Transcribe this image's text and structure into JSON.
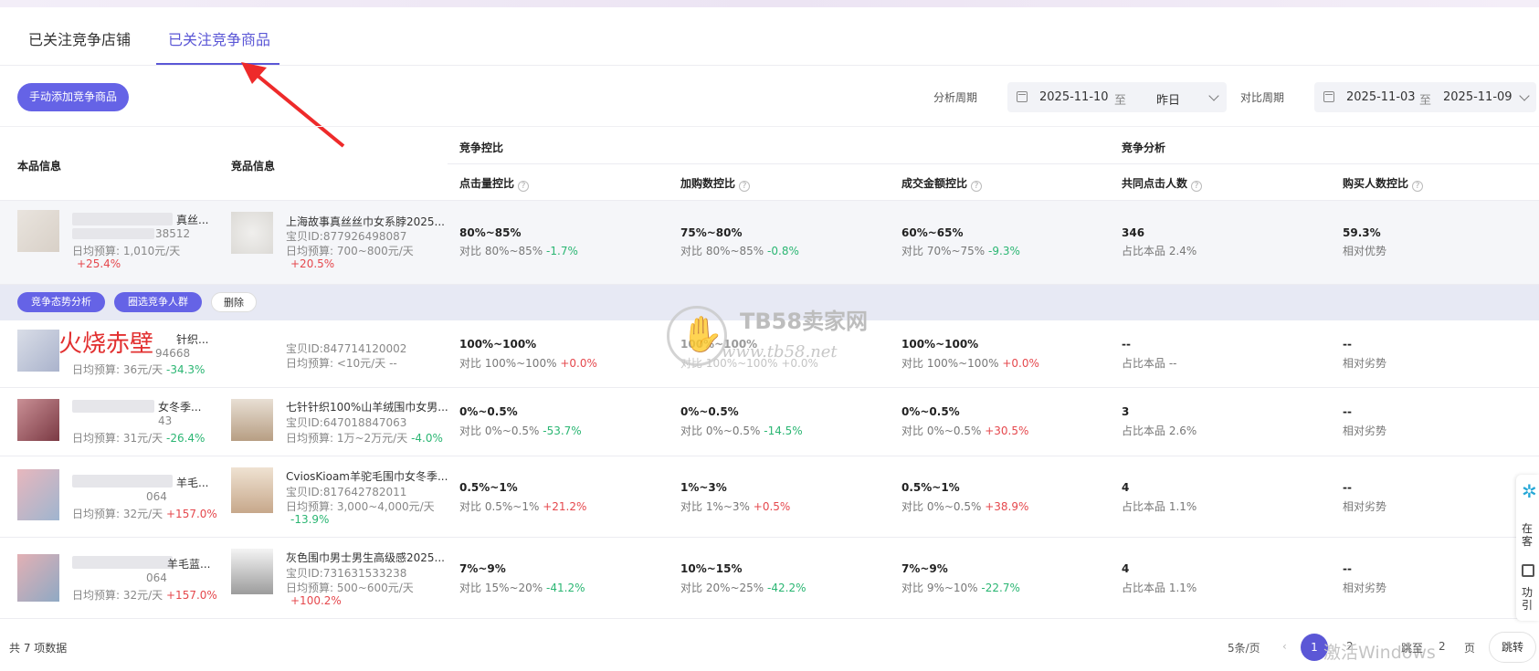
{
  "tabs": [
    "已关注竞争店铺",
    "已关注竞争商品"
  ],
  "toolbar": {
    "add_button": "手动添加竞争商品",
    "analysis_label": "分析周期",
    "analysis_start": "2025-11-10",
    "analysis_sep": "至",
    "analysis_end": "昨日",
    "compare_label": "对比周期",
    "compare_start": "2025-11-03",
    "compare_sep": "至",
    "compare_end": "2025-11-09"
  },
  "header": {
    "own": "本品信息",
    "competitor": "竞品信息",
    "group1": "竞争控比",
    "group2": "竞争分析",
    "cols": [
      "点击量控比",
      "加购数控比",
      "成交金额控比",
      "共同点击人数",
      "购买人数控比"
    ]
  },
  "rows": [
    {
      "own_title": "真丝...",
      "own_id": "38512",
      "own_budget": "日均预算: 1,010元/天",
      "own_change": "+25.4%",
      "comp_title": "上海故事真丝丝巾女系脖2025...",
      "comp_id": "宝贝ID:877926498087",
      "comp_budget": "日均预算: 700~800元/天",
      "comp_change": "+20.5%",
      "c1": "80%~85%",
      "c1_cmp": "对比 80%~85%",
      "c1_chg": "-1.7%",
      "c2": "75%~80%",
      "c2_cmp": "对比 80%~85%",
      "c2_chg": "-0.8%",
      "c3": "60%~65%",
      "c3_cmp": "对比 70%~75%",
      "c3_chg": "-9.3%",
      "c4": "346",
      "c4_sub": "占比本品 2.4%",
      "c5": "59.3%",
      "c5_sub": "相对优势"
    },
    {
      "own_title": "针织...",
      "own_id": "94668",
      "own_budget": "日均预算: 36元/天",
      "own_change": "-34.3%",
      "comp_title": "",
      "comp_id": "宝贝ID:847714120002",
      "comp_budget": "日均预算: <10元/天",
      "comp_change": "--",
      "c1": "100%~100%",
      "c1_cmp": "对比 100%~100%",
      "c1_chg": "+0.0%",
      "c2": "100%~100%",
      "c2_cmp": "对比 100%~100%",
      "c2_chg": "+0.0%",
      "c3": "100%~100%",
      "c3_cmp": "对比 100%~100%",
      "c3_chg": "+0.0%",
      "c4": "--",
      "c4_sub": "占比本品 --",
      "c5": "--",
      "c5_sub": "相对劣势"
    },
    {
      "own_title": "女冬季...",
      "own_id": "43",
      "own_budget": "日均预算: 31元/天",
      "own_change": "-26.4%",
      "comp_title": "七针针织100%山羊绒围巾女男...",
      "comp_id": "宝贝ID:647018847063",
      "comp_budget": "日均预算: 1万~2万元/天",
      "comp_change": "-4.0%",
      "c1": "0%~0.5%",
      "c1_cmp": "对比 0%~0.5%",
      "c1_chg": "-53.7%",
      "c2": "0%~0.5%",
      "c2_cmp": "对比 0%~0.5%",
      "c2_chg": "-14.5%",
      "c3": "0%~0.5%",
      "c3_cmp": "对比 0%~0.5%",
      "c3_chg": "+30.5%",
      "c4": "3",
      "c4_sub": "占比本品 2.6%",
      "c5": "--",
      "c5_sub": "相对劣势"
    },
    {
      "own_title": "羊毛...",
      "own_id": "064",
      "own_budget": "日均预算: 32元/天",
      "own_change": "+157.0%",
      "comp_title": "CviosKioam羊驼毛围巾女冬季...",
      "comp_id": "宝贝ID:817642782011",
      "comp_budget": "日均预算: 3,000~4,000元/天",
      "comp_change": "-13.9%",
      "c1": "0.5%~1%",
      "c1_cmp": "对比 0.5%~1%",
      "c1_chg": "+21.2%",
      "c2": "1%~3%",
      "c2_cmp": "对比 1%~3%",
      "c2_chg": "+0.5%",
      "c3": "0.5%~1%",
      "c3_cmp": "对比 0%~0.5%",
      "c3_chg": "+38.9%",
      "c4": "4",
      "c4_sub": "占比本品 1.1%",
      "c5": "--",
      "c5_sub": "相对劣势"
    },
    {
      "own_title": "羊毛蓝...",
      "own_id": "064",
      "own_budget": "日均预算: 32元/天",
      "own_change": "+157.0%",
      "comp_title": "灰色围巾男士男生高级感2025...",
      "comp_id": "宝贝ID:731631533238",
      "comp_budget": "日均预算: 500~600元/天",
      "comp_change": "+100.2%",
      "c1": "7%~9%",
      "c1_cmp": "对比 15%~20%",
      "c1_chg": "-41.2%",
      "c2": "10%~15%",
      "c2_cmp": "对比 20%~25%",
      "c2_chg": "-42.2%",
      "c3": "7%~9%",
      "c3_cmp": "对比 9%~10%",
      "c3_chg": "-22.7%",
      "c4": "4",
      "c4_sub": "占比本品 1.1%",
      "c5": "--",
      "c5_sub": "相对劣势"
    }
  ],
  "row_actions": [
    "竞争态势分析",
    "圈选竞争人群",
    "删除"
  ],
  "overlay_text": "火烧赤壁",
  "watermark": {
    "brand": "TB58卖家网",
    "url": "www.tb58.net"
  },
  "footer": {
    "total": "共 7 项数据",
    "page_size": "5条/页",
    "current_page": "1",
    "page2": "2",
    "jump_prefix": "跳至",
    "jump_value": "2",
    "jump_suffix": "页",
    "jump_button": "跳转",
    "activate_windows": "激活Windows"
  },
  "side_panel": {
    "item1": "在客",
    "item2": "功引"
  },
  "colors": {
    "accent": "#6563e6",
    "up": "#e5484d",
    "down": "#2bb673"
  }
}
